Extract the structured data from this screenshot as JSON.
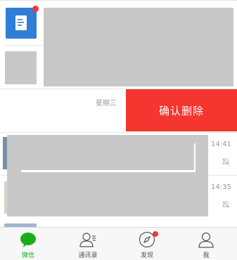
{
  "rows": [
    {
      "time": ""
    },
    {
      "time": ""
    },
    {
      "time": "星期三"
    },
    {
      "time": "14:41"
    },
    {
      "time": "14:35"
    }
  ],
  "swipe_action": {
    "label": "确认删除",
    "color": "#f43530"
  },
  "tabbar": {
    "items": [
      {
        "label": "微信",
        "active": true
      },
      {
        "label": "通讯录",
        "active": false
      },
      {
        "label": "发现",
        "active": false
      },
      {
        "label": "我",
        "active": false
      }
    ],
    "active_color": "#1aad19"
  }
}
